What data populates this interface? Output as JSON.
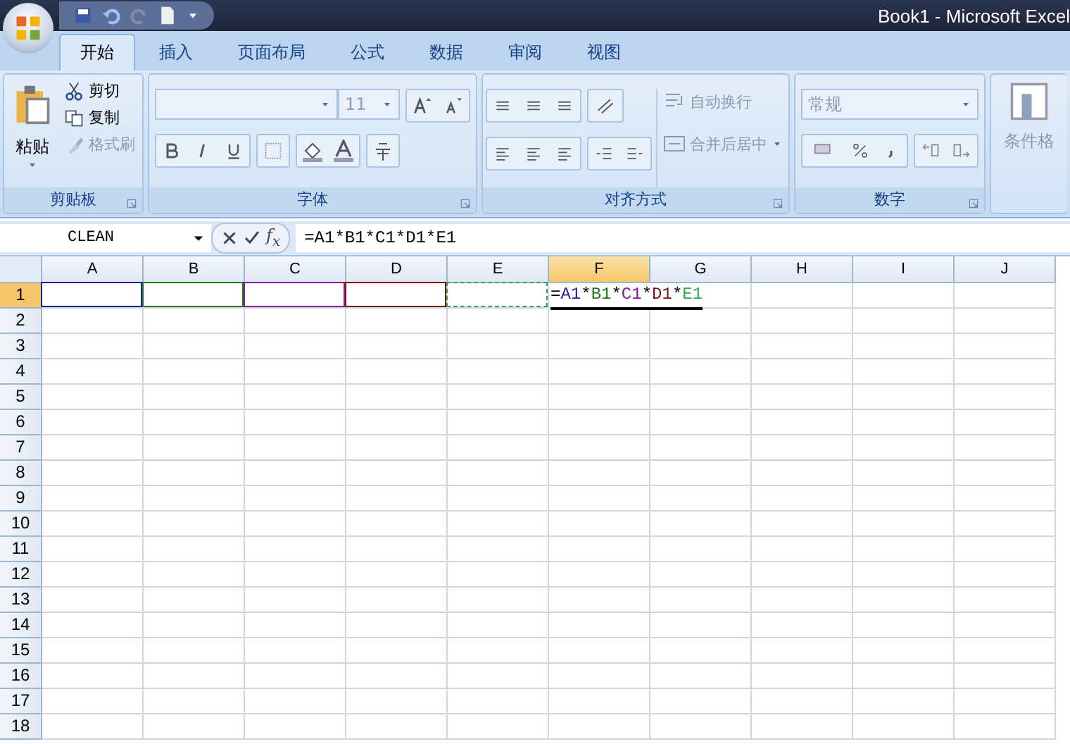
{
  "window": {
    "title": "Book1 - Microsoft Excel"
  },
  "tabs": [
    {
      "label": "开始",
      "selected": true
    },
    {
      "label": "插入",
      "selected": false
    },
    {
      "label": "页面布局",
      "selected": false
    },
    {
      "label": "公式",
      "selected": false
    },
    {
      "label": "数据",
      "selected": false
    },
    {
      "label": "审阅",
      "selected": false
    },
    {
      "label": "视图",
      "selected": false
    }
  ],
  "clipboard": {
    "paste": "粘贴",
    "items": [
      {
        "label": "剪切",
        "disabled": false
      },
      {
        "label": "复制",
        "disabled": false
      },
      {
        "label": "格式刷",
        "disabled": true
      }
    ],
    "group_label": "剪贴板"
  },
  "font": {
    "size": "11",
    "group_label": "字体"
  },
  "alignment": {
    "wrap": "自动换行",
    "merge": "合并后居中",
    "group_label": "对齐方式"
  },
  "number": {
    "format": "常规",
    "group_label": "数字"
  },
  "styles": {
    "conditional": "条件格"
  },
  "formula_bar": {
    "name_box": "CLEAN",
    "function_button": "f$_{x}$",
    "formula": "=A1*B1*C1*D1*E1"
  },
  "sheet": {
    "columns": [
      {
        "label": "A",
        "selected": false
      },
      {
        "label": "B",
        "selected": false
      },
      {
        "label": "C",
        "selected": false
      },
      {
        "label": "D",
        "selected": false
      },
      {
        "label": "E",
        "selected": false
      },
      {
        "label": "F",
        "selected": true
      },
      {
        "label": "G",
        "selected": false
      },
      {
        "label": "H",
        "selected": false
      },
      {
        "label": "I",
        "selected": false
      },
      {
        "label": "J",
        "selected": false
      }
    ],
    "rows": [
      {
        "label": "1",
        "selected": true
      },
      {
        "label": "2",
        "selected": false
      },
      {
        "label": "3",
        "selected": false
      },
      {
        "label": "4",
        "selected": false
      },
      {
        "label": "5",
        "selected": false
      },
      {
        "label": "6",
        "selected": false
      },
      {
        "label": "7",
        "selected": false
      },
      {
        "label": "8",
        "selected": false
      },
      {
        "label": "9",
        "selected": false
      },
      {
        "label": "10",
        "selected": false
      },
      {
        "label": "11",
        "selected": false
      },
      {
        "label": "12",
        "selected": false
      },
      {
        "label": "13",
        "selected": false
      },
      {
        "label": "14",
        "selected": false
      },
      {
        "label": "15",
        "selected": false
      },
      {
        "label": "16",
        "selected": false
      },
      {
        "label": "17",
        "selected": false
      },
      {
        "label": "18",
        "selected": false
      }
    ],
    "edit_cell": {
      "parts": [
        {
          "text": "=",
          "kind": "op"
        },
        {
          "text": "A1",
          "kind": "ref",
          "color": "#1f1f9c"
        },
        {
          "text": "*",
          "kind": "op"
        },
        {
          "text": "B1",
          "kind": "ref",
          "color": "#1f7a1f"
        },
        {
          "text": "*",
          "kind": "op"
        },
        {
          "text": "C1",
          "kind": "ref",
          "color": "#8a1a9a"
        },
        {
          "text": "*",
          "kind": "op"
        },
        {
          "text": "D1",
          "kind": "ref",
          "color": "#7a1010"
        },
        {
          "text": "*",
          "kind": "op"
        },
        {
          "text": "E1",
          "kind": "ref",
          "color": "#2ea84a"
        }
      ]
    }
  }
}
